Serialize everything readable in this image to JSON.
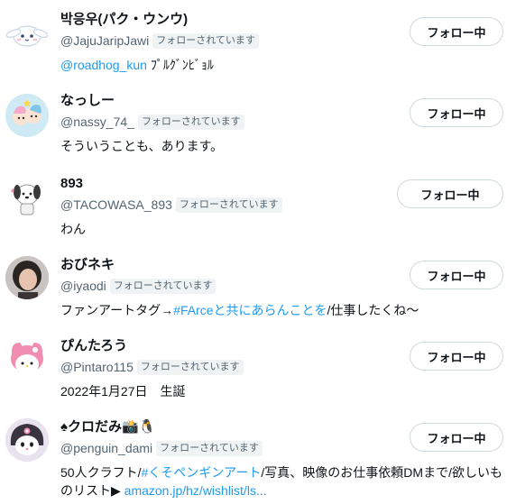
{
  "follow_label": "フォロー中",
  "follows_you_label": "フォローされています",
  "users": [
    {
      "name": "박응우(パク・ウンウ)",
      "handle": "@JajuJaripJawi",
      "bio_link": "@roadhog_kun",
      "bio_text": " ﾌﾟﾙｸﾞﾝﾋﾞｮﾙ",
      "avatar_icon": "cinnamoroll-avatar"
    },
    {
      "name": "なっしー",
      "handle": "@nassy_74_",
      "bio_text": "そういうことも、あります。",
      "avatar_icon": "twin-stars-avatar"
    },
    {
      "name": "893",
      "handle": "@TACOWASA_893",
      "bio_text": "わん",
      "avatar_icon": "pochacco-avatar"
    },
    {
      "name": "おびネキ",
      "handle": "@iyaodi",
      "bio_pre": "ファンアートタグ→",
      "bio_link": "#FArceと共にあらんことを",
      "bio_post": "/仕事したくね〜",
      "avatar_icon": "person-photo-avatar"
    },
    {
      "name": "ぴんたろう",
      "handle": "@Pintaro115",
      "bio_text": "2022年1月27日　生誕",
      "avatar_icon": "my-melody-avatar"
    },
    {
      "name": "♠クロだみ📸🐧",
      "handle": "@penguin_dami",
      "bio_pre": "50人クラフト/",
      "bio_link": "#くそペンギンアート",
      "bio_post": "/写真、映像のお仕事依頼DMまで/欲しいものリスト▶ ",
      "bio_url": "amazon.jp/hz/wishlist/ls...",
      "avatar_icon": "kuromi-avatar"
    }
  ]
}
